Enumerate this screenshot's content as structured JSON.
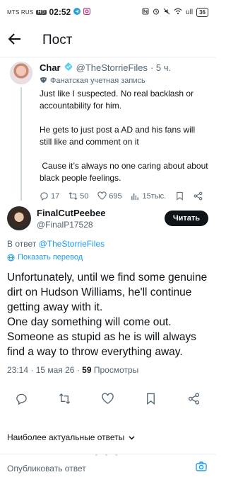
{
  "statusbar": {
    "carrier": "MTS RUS",
    "badge": "HD",
    "time": "02:52",
    "signal": "ull",
    "battery": "36"
  },
  "header": {
    "title": "Пост"
  },
  "parent_tweet": {
    "name": "Char",
    "handle": "@TheStorrieFiles",
    "age": "· 5 ч.",
    "label": "Фанатская учетная запись",
    "text": "Just like I suspected. No real backlash or accountability for him.\n\nHe gets to just post a AD and his fans will still like and comment on it\n\n Cause it’s always no one caring about about black people feelings.",
    "replies": "17",
    "retweets": "50",
    "likes": "695",
    "views": "15тыс."
  },
  "main_tweet": {
    "name": "FinalCutPeebee",
    "handle": "@FinalP17528",
    "follow_label": "Читать",
    "reply_prefix": "В ответ ",
    "reply_handle": "@TheStorrieFiles",
    "translate_label": "Показать перевод",
    "text": "Unfortunately, until we find some genuine dirt on Hudson Williams, he'll continue getting away with it.\nOne day something will come out.\nSomeone as stupid as he is will always find a way to throw everything away.",
    "timestamp": "23:14 · 15 мая 26 · ",
    "views_count": "59",
    "views_label": " Просмотры"
  },
  "replies_sort": {
    "label": "Наиболее актуальные ответы"
  },
  "compose": {
    "placeholder": "Опубликовать ответ"
  },
  "colors": {
    "accent": "#1d9bf0",
    "text": "#0f1419",
    "muted": "#536471",
    "divider": "#e6ecf0"
  }
}
